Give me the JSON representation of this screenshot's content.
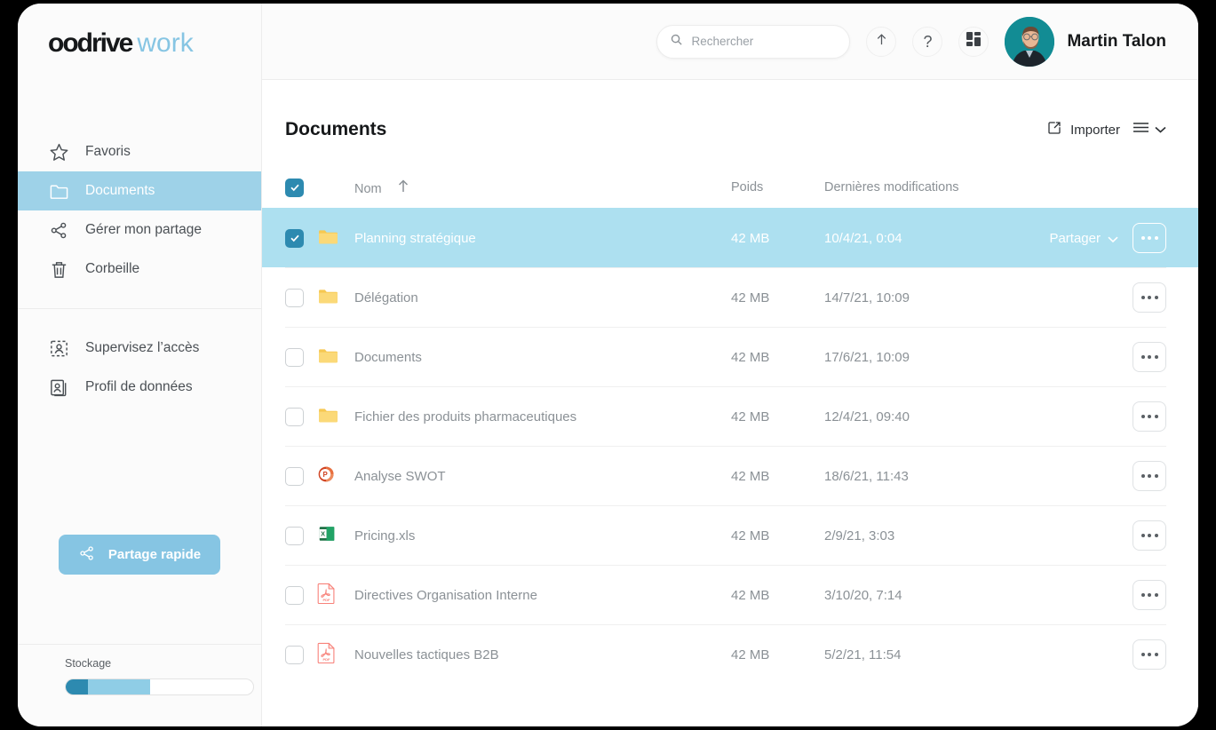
{
  "brand": {
    "name": "oodrive",
    "suffix": "work",
    "accent": "#86c5e3"
  },
  "sidebar": {
    "items": [
      {
        "label": "Favoris",
        "icon": "star-icon",
        "active": false
      },
      {
        "label": "Documents",
        "icon": "folder-icon",
        "active": true
      },
      {
        "label": "Gérer mon partage",
        "icon": "share-icon",
        "active": false
      },
      {
        "label": "Corbeille",
        "icon": "trash-icon",
        "active": false
      }
    ],
    "items_secondary": [
      {
        "label": "Supervisez l’accès",
        "icon": "supervise-access-icon"
      },
      {
        "label": "Profil de données",
        "icon": "data-profile-icon"
      }
    ],
    "quick_share_label": "Partage rapide",
    "storage_label": "Stockage",
    "storage_used_pct": 45
  },
  "topbar": {
    "search_placeholder": "Rechercher",
    "search_value": "",
    "upload_icon": "upload-arrow-icon",
    "help_icon": "question-mark-icon",
    "apps_icon": "apps-grid-icon",
    "user_name": "Martin Talon"
  },
  "page": {
    "title": "Documents",
    "import_label": "Importer",
    "columns": {
      "name": "Nom",
      "size": "Poids",
      "modified": "Dernières modifications"
    },
    "sort_direction": "asc",
    "select_all_checked": true,
    "share_label": "Partager"
  },
  "files": [
    {
      "name": "Planning stratégique",
      "type": "folder",
      "size": "42 MB",
      "modified": "10/4/21, 0:04",
      "selected": true
    },
    {
      "name": "Délégation",
      "type": "folder",
      "size": "42 MB",
      "modified": "14/7/21, 10:09",
      "selected": false
    },
    {
      "name": "Documents",
      "type": "folder",
      "size": "42 MB",
      "modified": "17/6/21, 10:09",
      "selected": false
    },
    {
      "name": "Fichier des produits pharmaceutiques",
      "type": "folder",
      "size": "42 MB",
      "modified": "12/4/21, 09:40",
      "selected": false
    },
    {
      "name": "Analyse SWOT",
      "type": "powerpoint",
      "size": "42 MB",
      "modified": "18/6/21, 11:43",
      "selected": false
    },
    {
      "name": "Pricing.xls",
      "type": "excel",
      "size": "42 MB",
      "modified": "2/9/21, 3:03",
      "selected": false
    },
    {
      "name": "Directives Organisation Interne",
      "type": "pdf",
      "size": "42 MB",
      "modified": "3/10/20, 7:14",
      "selected": false
    },
    {
      "name": "Nouvelles tactiques B2B",
      "type": "pdf",
      "size": "42 MB",
      "modified": "5/2/21, 11:54",
      "selected": false
    }
  ]
}
